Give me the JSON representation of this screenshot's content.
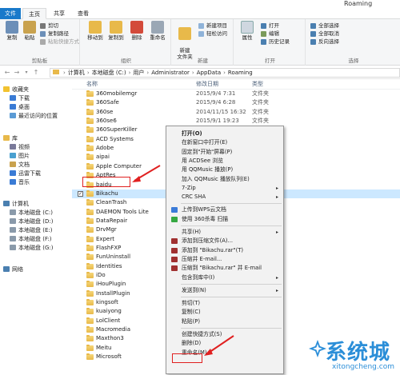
{
  "window": {
    "title": "Roaming"
  },
  "tabs": [
    "文件",
    "主页",
    "共享",
    "查看"
  ],
  "ribbon": {
    "clipboard": {
      "label": "剪贴板",
      "copy": "复制",
      "paste": "粘贴",
      "cut": "剪切",
      "copy_path": "复制路径",
      "paste_shortcut": "粘贴快捷方式"
    },
    "organize": {
      "label": "组织",
      "move_to": "移动到",
      "copy_to": "复制到",
      "delete": "删除",
      "rename": "重命名"
    },
    "new": {
      "label": "新建",
      "new_folder": "新建\n文件夹",
      "new_item": "新建项目",
      "easy_access": "轻松访问"
    },
    "open": {
      "label": "打开",
      "properties": "属性",
      "open": "打开",
      "edit": "编辑",
      "history": "历史记录"
    },
    "select": {
      "label": "选择",
      "select_all": "全部选择",
      "select_none": "全部取消",
      "invert": "反向选择"
    }
  },
  "address": {
    "crumbs": [
      "计算机",
      "本地磁盘 (C:)",
      "用户",
      "Administrator",
      "AppData",
      "Roaming"
    ]
  },
  "navpane": {
    "items": [
      {
        "label": "收藏夹",
        "icon": "star-icon",
        "color": "#f2c230"
      },
      {
        "label": "下载",
        "icon": "download-folder-icon",
        "color": "#3a7bd5"
      },
      {
        "label": "桌面",
        "icon": "desktop-icon",
        "color": "#3a7bd5"
      },
      {
        "label": "最近访问的位置",
        "icon": "recent-places-icon",
        "color": "#5b9bd5"
      },
      {
        "label": "库",
        "icon": "library-icon",
        "color": "#e8b94a"
      },
      {
        "label": "视频",
        "icon": "videos-icon",
        "color": "#7a7a9a"
      },
      {
        "label": "图片",
        "icon": "pictures-icon",
        "color": "#4aa0d0"
      },
      {
        "label": "文档",
        "icon": "documents-icon",
        "color": "#c9a24e"
      },
      {
        "label": "迅雷下载",
        "icon": "thunder-download-icon",
        "color": "#3a7bd5"
      },
      {
        "label": "音乐",
        "icon": "music-icon",
        "color": "#3a7bd5"
      },
      {
        "label": "计算机",
        "icon": "computer-icon",
        "color": "#4a7fb0"
      },
      {
        "label": "本地磁盘 (C:)",
        "icon": "drive-icon",
        "color": "#8a9aaa"
      },
      {
        "label": "本地磁盘 (D:)",
        "icon": "drive-icon",
        "color": "#8a9aaa"
      },
      {
        "label": "本地磁盘 (E:)",
        "icon": "drive-icon",
        "color": "#8a9aaa"
      },
      {
        "label": "本地磁盘 (F:)",
        "icon": "drive-icon",
        "color": "#8a9aaa"
      },
      {
        "label": "本地磁盘 (G:)",
        "icon": "drive-icon",
        "color": "#8a9aaa"
      },
      {
        "label": "网络",
        "icon": "network-icon",
        "color": "#4a7fb0"
      }
    ]
  },
  "columns": {
    "name": "名称",
    "date": "修改日期",
    "type": "类型"
  },
  "files": [
    {
      "name": "360mobilemgr",
      "date": "2015/9/4 7:31",
      "type": "文件夹"
    },
    {
      "name": "360Safe",
      "date": "2015/9/4 6:28",
      "type": "文件夹"
    },
    {
      "name": "360se",
      "date": "2014/11/15 16:32",
      "type": "文件夹"
    },
    {
      "name": "360se6",
      "date": "2015/9/1 19:23",
      "type": "文件夹"
    },
    {
      "name": "360SuperKiller",
      "date": "",
      "type": ""
    },
    {
      "name": "ACD Systems",
      "date": "",
      "type": ""
    },
    {
      "name": "Adobe",
      "date": "",
      "type": ""
    },
    {
      "name": "aipai",
      "date": "",
      "type": ""
    },
    {
      "name": "Apple Computer",
      "date": "",
      "type": ""
    },
    {
      "name": "AptRes",
      "date": "",
      "type": ""
    },
    {
      "name": "baidu",
      "date": "",
      "type": ""
    },
    {
      "name": "Bikachu",
      "date": "",
      "type": "",
      "selected": true
    },
    {
      "name": "CleanTrash",
      "date": "",
      "type": ""
    },
    {
      "name": "DAEMON Tools Lite",
      "date": "",
      "type": ""
    },
    {
      "name": "DataRepair",
      "date": "",
      "type": ""
    },
    {
      "name": "DrvMgr",
      "date": "",
      "type": ""
    },
    {
      "name": "Expert",
      "date": "",
      "type": ""
    },
    {
      "name": "FlashFXP",
      "date": "",
      "type": ""
    },
    {
      "name": "FunUninstall",
      "date": "",
      "type": ""
    },
    {
      "name": "Identities",
      "date": "",
      "type": ""
    },
    {
      "name": "iDo",
      "date": "",
      "type": ""
    },
    {
      "name": "iHouPlugin",
      "date": "",
      "type": ""
    },
    {
      "name": "InstallPlugin",
      "date": "",
      "type": ""
    },
    {
      "name": "kingsoft",
      "date": "",
      "type": ""
    },
    {
      "name": "kuaiyong",
      "date": "",
      "type": ""
    },
    {
      "name": "LolClient",
      "date": "",
      "type": ""
    },
    {
      "name": "Macromedia",
      "date": "",
      "type": ""
    },
    {
      "name": "Maxthon3",
      "date": "",
      "type": ""
    },
    {
      "name": "Meitu",
      "date": "",
      "type": ""
    },
    {
      "name": "Microsoft",
      "date": "",
      "type": ""
    }
  ],
  "context_menu": {
    "items": [
      {
        "label": "打开(O)",
        "bold": true
      },
      {
        "label": "在新窗口中打开(E)"
      },
      {
        "label": "固定到\"开始\"屏幕(P)"
      },
      {
        "label": "用 ACDSee 浏览"
      },
      {
        "label": "用 QQMusic 播放(P)"
      },
      {
        "label": "加入 QQMusic 播放队列(E)"
      },
      {
        "label": "7-Zip",
        "submenu": true
      },
      {
        "label": "CRC SHA",
        "submenu": true
      },
      {
        "sep": true
      },
      {
        "label": "上传到WPS云文档",
        "icon": "#3b7bd8"
      },
      {
        "label": "使用 360杀毒 扫描",
        "icon": "#36a842"
      },
      {
        "sep": true
      },
      {
        "label": "共享(H)",
        "submenu": true
      },
      {
        "label": "添加到压缩文件(A)...",
        "icon": "#a03030"
      },
      {
        "label": "添加到 \"Bikachu.rar\"(T)",
        "icon": "#a03030"
      },
      {
        "label": "压缩并 E-mail...",
        "icon": "#a03030"
      },
      {
        "label": "压缩到 \"Bikachu.rar\" 并 E-mail",
        "icon": "#a03030"
      },
      {
        "label": "包含到库中(I)",
        "submenu": true
      },
      {
        "sep": true
      },
      {
        "label": "发送到(N)",
        "submenu": true
      },
      {
        "sep": true
      },
      {
        "label": "剪切(T)"
      },
      {
        "label": "复制(C)"
      },
      {
        "label": "粘贴(P)"
      },
      {
        "sep": true
      },
      {
        "label": "创建快捷方式(S)"
      },
      {
        "label": "删除(D)",
        "highlight": true
      },
      {
        "label": "重命名(M)"
      }
    ]
  },
  "watermark": {
    "brand": "系统城",
    "url": "xitongcheng.com"
  },
  "colors": {
    "accent": "#1979ca",
    "annotation_red": "#e02020",
    "selection": "#cce8ff",
    "watermark_blue": "#2b8ed8"
  }
}
